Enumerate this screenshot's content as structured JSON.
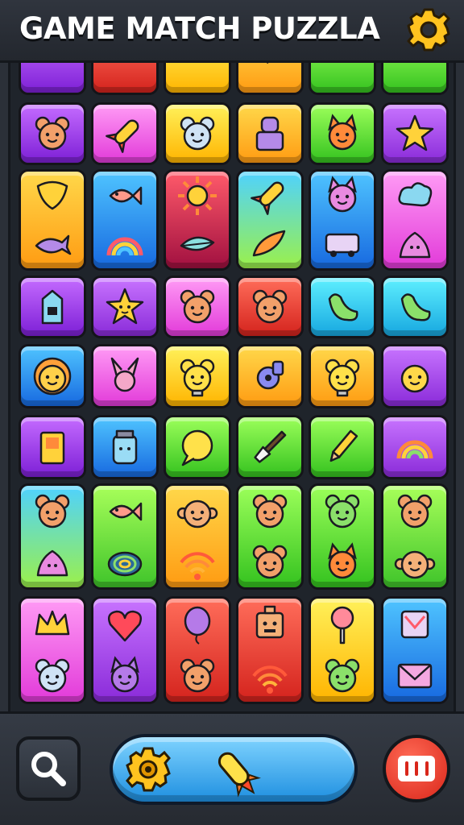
{
  "header": {
    "title": "GAME MATCH PUZZLA",
    "settings_icon": "gear-icon"
  },
  "colors": {
    "purple": [
      "#c46bff",
      "#7d1fd6"
    ],
    "red": [
      "#ff6d5a",
      "#d4231d"
    ],
    "yellow": [
      "#fff15a",
      "#ffb400"
    ],
    "orange": [
      "#ffd84a",
      "#ff9b12"
    ],
    "green": [
      "#9cff5a",
      "#34c21f"
    ],
    "pink": [
      "#ff9bf5",
      "#e23ad9"
    ],
    "blue": [
      "#4fc4ff",
      "#1769e0"
    ],
    "cyan": [
      "#5ff0ff",
      "#17a7e0"
    ],
    "crimson": [
      "#ff5a6a",
      "#a11040"
    ],
    "cyangreen": [
      "#4fd2ff",
      "#9bf04a"
    ],
    "lime": [
      "#a8ff5a",
      "#3fc42a"
    ],
    "violet": [
      "#c874ff",
      "#8a2bd9"
    ]
  },
  "board": {
    "rows": [
      {
        "name": "row-0",
        "tiles": [
          {
            "color": "purple",
            "icons": [
              "pencil-icon"
            ]
          },
          {
            "color": "red",
            "icons": [
              "monkey-face-icon"
            ]
          },
          {
            "color": "yellow",
            "icons": [
              "fox-face-icon"
            ]
          },
          {
            "color": "orange",
            "icons": [
              "rocket-icon"
            ]
          },
          {
            "color": "green",
            "icons": [
              "picture-frame-icon"
            ]
          },
          {
            "color": "green",
            "icons": [
              "frog-face-icon"
            ]
          }
        ]
      },
      {
        "name": "row-1",
        "tiles": [
          {
            "color": "purple",
            "icons": [
              "bear-face-icon"
            ]
          },
          {
            "color": "pink",
            "icons": [
              "rocket-icon"
            ]
          },
          {
            "color": "yellow",
            "icons": [
              "koala-face-icon"
            ]
          },
          {
            "color": "orange",
            "icons": [
              "robot-figure-icon"
            ]
          },
          {
            "color": "green",
            "icons": [
              "fox-face-icon"
            ]
          },
          {
            "color": "violet",
            "icons": [
              "star-icon"
            ]
          }
        ]
      },
      {
        "name": "row-2",
        "tall": true,
        "tiles": [
          {
            "color": "orange",
            "icons": [
              "shield-icon",
              "whale-icon"
            ]
          },
          {
            "color": "blue",
            "icons": [
              "fish-icon",
              "rainbow-icon"
            ]
          },
          {
            "color": "crimson",
            "icons": [
              "sun-icon",
              "leaf-icon"
            ]
          },
          {
            "color": "cyangreen",
            "icons": [
              "rocket-icon",
              "feather-icon"
            ]
          },
          {
            "color": "blue",
            "icons": [
              "octopus-face-icon",
              "bus-icon"
            ]
          },
          {
            "color": "pink",
            "icons": [
              "cloud-icon",
              "slime-icon"
            ]
          }
        ]
      },
      {
        "name": "row-3",
        "tiles": [
          {
            "color": "purple",
            "icons": [
              "milk-carton-icon"
            ]
          },
          {
            "color": "violet",
            "icons": [
              "star-face-icon"
            ]
          },
          {
            "color": "pink",
            "icons": [
              "bear-face-icon"
            ]
          },
          {
            "color": "red",
            "icons": [
              "bear-face-icon"
            ]
          },
          {
            "color": "cyan",
            "icons": [
              "seal-icon"
            ]
          },
          {
            "color": "cyan",
            "icons": [
              "seal-icon"
            ]
          }
        ]
      },
      {
        "name": "row-4",
        "tiles": [
          {
            "color": "blue",
            "icons": [
              "sun-face-icon"
            ]
          },
          {
            "color": "pink",
            "icons": [
              "bunny-icon"
            ]
          },
          {
            "color": "yellow",
            "icons": [
              "lightbulb-creature-icon"
            ]
          },
          {
            "color": "orange",
            "icons": [
              "whistle-icon"
            ]
          },
          {
            "color": "orange",
            "icons": [
              "lightbulb-creature-icon"
            ]
          },
          {
            "color": "violet",
            "icons": [
              "chick-face-icon"
            ]
          }
        ]
      },
      {
        "name": "row-5",
        "tiles": [
          {
            "color": "purple",
            "icons": [
              "battery-icon"
            ]
          },
          {
            "color": "blue",
            "icons": [
              "jar-face-icon"
            ]
          },
          {
            "color": "green",
            "icons": [
              "chat-bubble-icon"
            ]
          },
          {
            "color": "green",
            "icons": [
              "brush-icon"
            ]
          },
          {
            "color": "green",
            "icons": [
              "pencil-icon"
            ]
          },
          {
            "color": "violet",
            "icons": [
              "rainbow-shell-icon"
            ]
          }
        ]
      },
      {
        "name": "row-6",
        "tall": true,
        "tiles": [
          {
            "color": "cyangreen",
            "icons": [
              "bear-face-icon",
              "slime-icon"
            ]
          },
          {
            "color": "lime",
            "icons": [
              "fish-icon",
              "spiral-icon"
            ]
          },
          {
            "color": "orange",
            "icons": [
              "monkey-face-icon",
              "wifi-icon"
            ]
          },
          {
            "color": "green",
            "icons": [
              "bear-face-icon",
              "bear-face-icon"
            ]
          },
          {
            "color": "green",
            "icons": [
              "frog-face-icon",
              "fox-face-icon"
            ]
          },
          {
            "color": "lime",
            "icons": [
              "bear-face-icon",
              "monkey-face-icon"
            ]
          }
        ]
      },
      {
        "name": "row-7",
        "tall": true,
        "tiles": [
          {
            "color": "pink",
            "icons": [
              "crown-icon",
              "koala-face-icon"
            ]
          },
          {
            "color": "violet",
            "icons": [
              "heart-icon",
              "cat-face-icon"
            ]
          },
          {
            "color": "red",
            "icons": [
              "balloon-icon",
              "bear-face-icon"
            ]
          },
          {
            "color": "red",
            "icons": [
              "robot-face-icon",
              "wifi-icon"
            ]
          },
          {
            "color": "yellow",
            "icons": [
              "lollipop-icon",
              "frog-face-icon"
            ]
          },
          {
            "color": "blue",
            "icons": [
              "mailbox-icon",
              "envelope-icon"
            ]
          }
        ]
      }
    ]
  },
  "bottom_bar": {
    "search_icon": "magnifier-icon",
    "powerups": [
      "gear-powerup-icon",
      "rocket-powerup-icon"
    ],
    "pause_icon": "pause-icon"
  }
}
